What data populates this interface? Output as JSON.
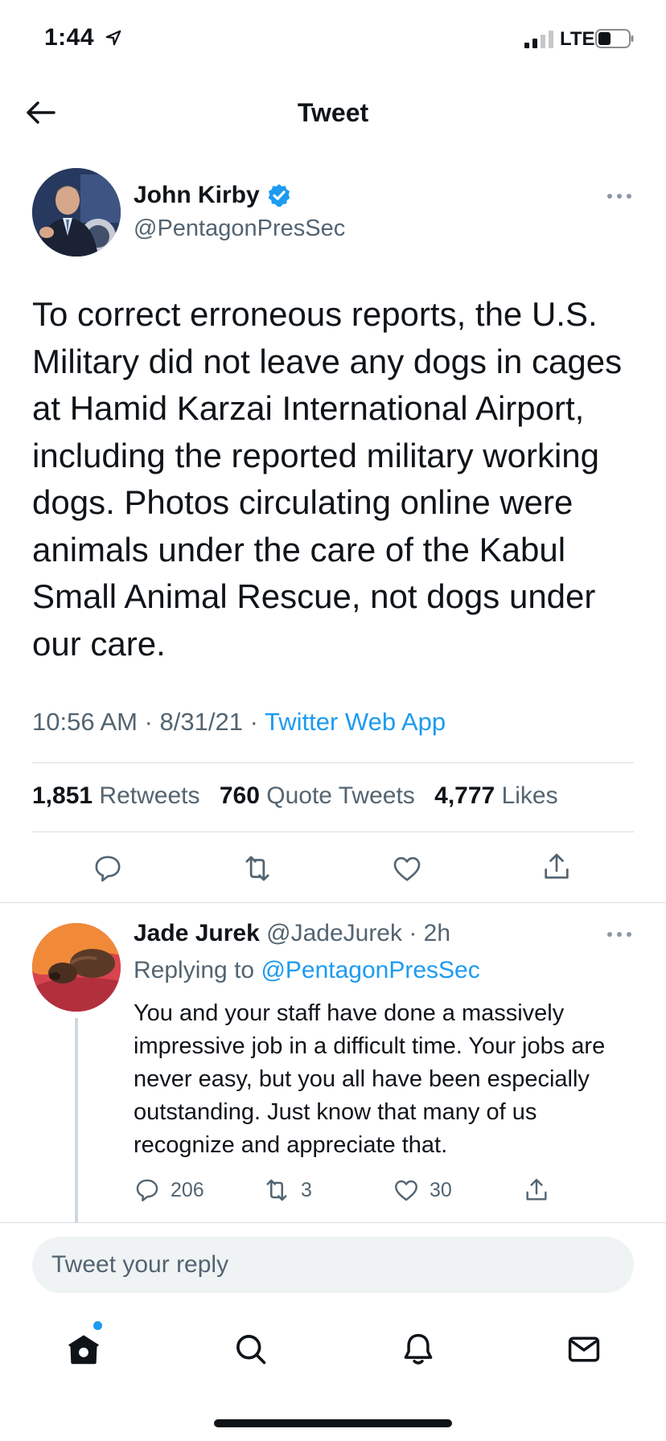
{
  "status_bar": {
    "time": "1:44",
    "network": "LTE"
  },
  "header": {
    "title": "Tweet"
  },
  "tweet": {
    "author_name": "John Kirby",
    "author_handle": "@PentagonPresSec",
    "text": "To correct erroneous reports, the U.S. Military did not leave any dogs in cages at Hamid Karzai International Airport, including the reported military working dogs. Photos circulating online were animals under the care of the Kabul Small Animal Rescue, not dogs under our care.",
    "time": "10:56 AM",
    "date": "8/31/21",
    "source": "Twitter Web App",
    "retweets_count": "1,851",
    "retweets_label": "Retweets",
    "quotes_count": "760",
    "quotes_label": "Quote Tweets",
    "likes_count": "4,777",
    "likes_label": "Likes"
  },
  "reply": {
    "author_name": "Jade Jurek",
    "author_handle": "@JadeJurek",
    "age": "2h",
    "replying_label": "Replying to",
    "replying_to": "@PentagonPresSec",
    "text": "You and your staff have done a massively impressive job in a difficult time. Your jobs are never easy, but you all have been especially outstanding. Just know that many of us recognize and appreciate that.",
    "reply_count": "206",
    "retweet_count": "3",
    "like_count": "30"
  },
  "compose": {
    "placeholder": "Tweet your reply"
  },
  "colors": {
    "accent": "#1d9bf0",
    "text": "#0f1419",
    "secondary": "#536471",
    "divider": "#d9dde1"
  },
  "icons": {
    "status": [
      "location-arrow-icon",
      "signal-icon",
      "battery-icon"
    ],
    "tweet_actions": [
      "reply-icon",
      "retweet-icon",
      "like-icon",
      "share-icon"
    ],
    "nav": [
      "home-icon",
      "search-icon",
      "notifications-icon",
      "messages-icon"
    ]
  }
}
